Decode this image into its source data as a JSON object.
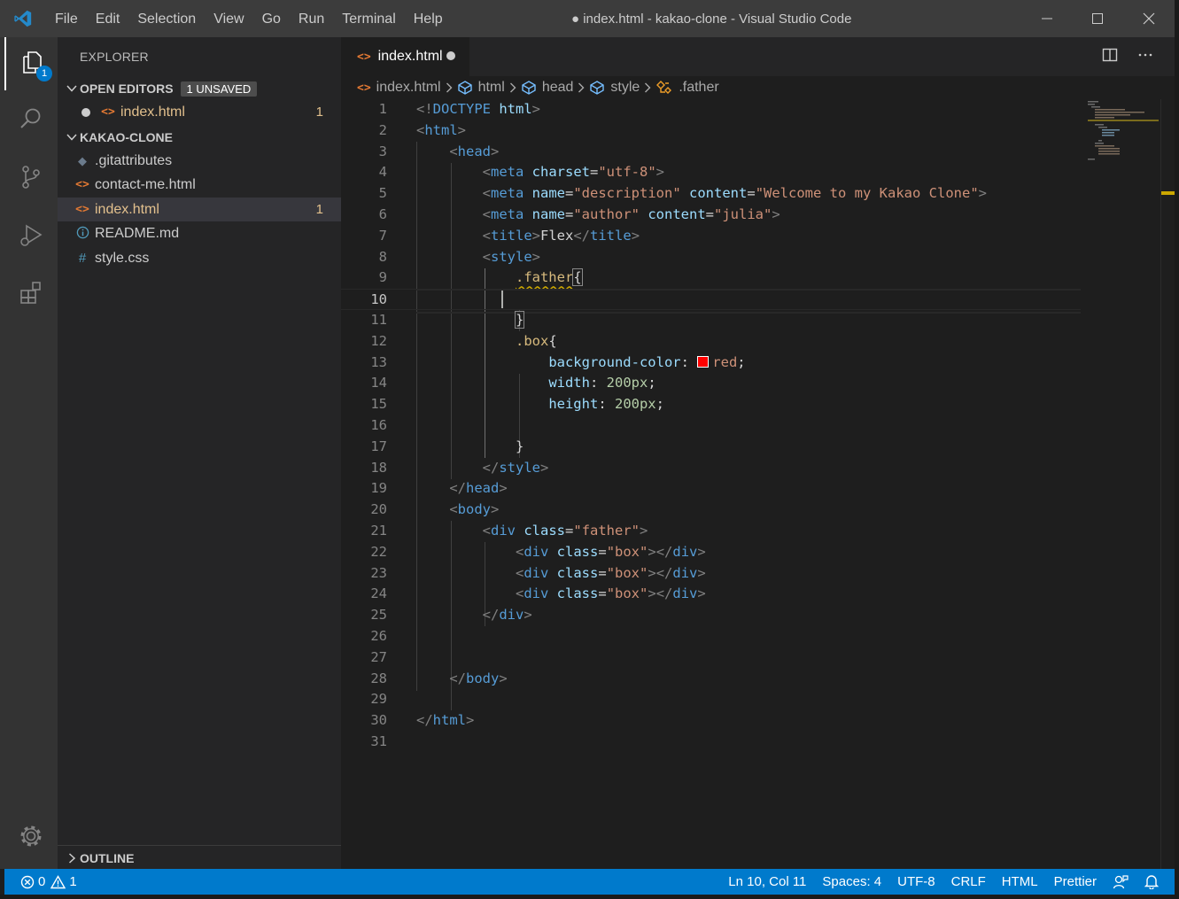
{
  "window": {
    "title": "● index.html - kakao-clone - Visual Studio Code",
    "menu": [
      "File",
      "Edit",
      "Selection",
      "View",
      "Go",
      "Run",
      "Terminal",
      "Help"
    ]
  },
  "activity_bar": {
    "explorer_badge": "1"
  },
  "sidebar": {
    "title": "EXPLORER",
    "open_editors": {
      "label": "OPEN EDITORS",
      "badge": "1 UNSAVED",
      "items": [
        {
          "name": "index.html",
          "count": "1"
        }
      ]
    },
    "folder": {
      "label": "KAKAO-CLONE",
      "items": [
        {
          "name": ".gitattributes",
          "icon": "git-file-icon"
        },
        {
          "name": "contact-me.html",
          "icon": "html-file-icon"
        },
        {
          "name": "index.html",
          "icon": "html-file-icon",
          "count": "1"
        },
        {
          "name": "README.md",
          "icon": "info-file-icon"
        },
        {
          "name": "style.css",
          "icon": "css-file-icon"
        }
      ]
    },
    "outline_label": "OUTLINE"
  },
  "editor": {
    "tab_label": "index.html",
    "breadcrumbs": [
      "index.html",
      "html",
      "head",
      "style",
      ".father"
    ],
    "line_numbers": [
      "1",
      "2",
      "3",
      "4",
      "5",
      "6",
      "7",
      "8",
      "9",
      "10",
      "11",
      "12",
      "13",
      "14",
      "15",
      "16",
      "17",
      "18",
      "19",
      "20",
      "21",
      "22",
      "23",
      "24",
      "25",
      "26",
      "27",
      "28",
      "29",
      "30",
      "31"
    ]
  },
  "status_bar": {
    "errors": "0",
    "warnings": "1",
    "position": "Ln 10, Col 11",
    "spaces": "Spaces: 4",
    "encoding": "UTF-8",
    "eol": "CRLF",
    "language": "HTML",
    "formatter": "Prettier"
  },
  "colors": {
    "accent": "#007acc",
    "modified": "#e2c08d",
    "swatch_red": "#ff0000"
  }
}
